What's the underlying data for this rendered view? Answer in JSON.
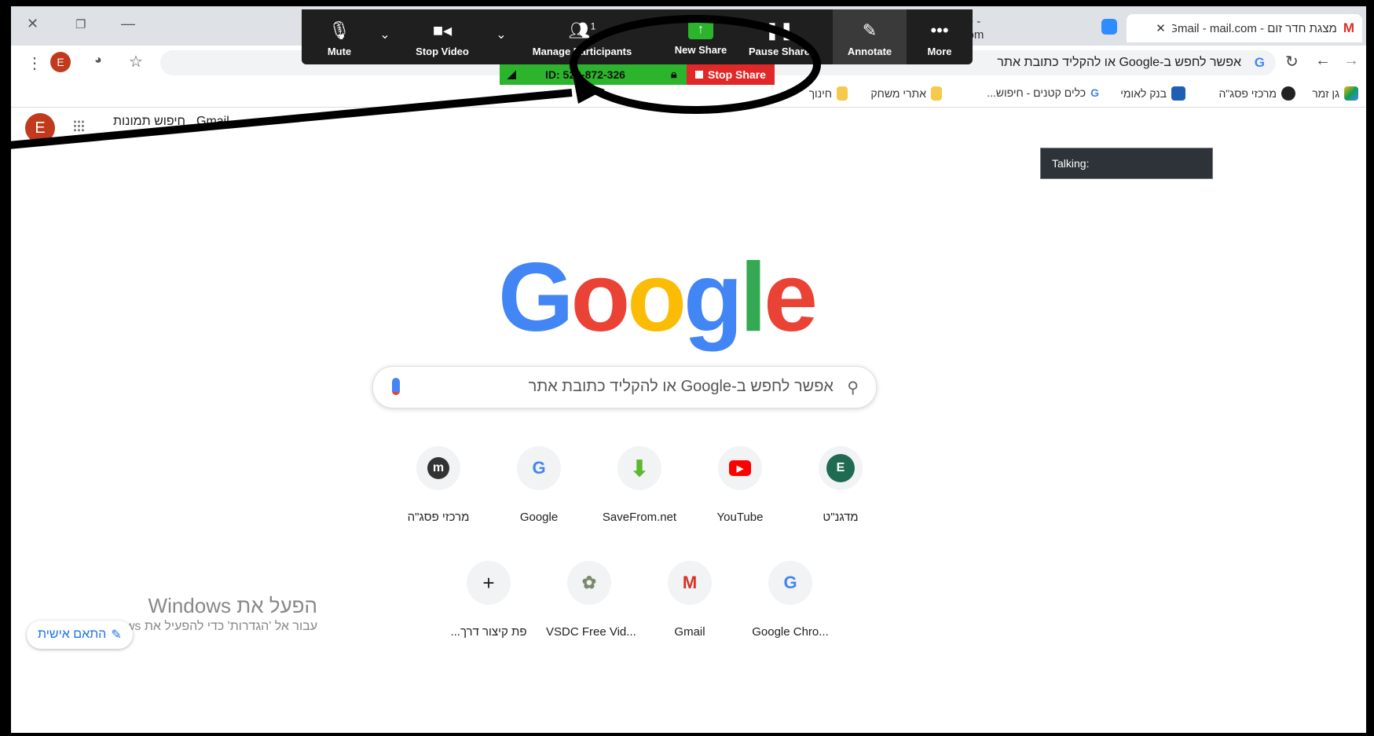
{
  "browser": {
    "tabs": [
      {
        "title": "dee - Zoom"
      },
      {
        "title": "מצגת חדר זום - Gmail - mail.com"
      }
    ],
    "omnibox_text": "אפשר לחפש ב-Google או להקליד כתובת אתר",
    "profile_initial": "E",
    "bookmarks": [
      {
        "label": "גן זמר"
      },
      {
        "label": "מרכזי פסג\"ה"
      },
      {
        "label": "בנק לאומי"
      },
      {
        "label": "כלים קטנים - חיפוש..."
      },
      {
        "label": "אתרי משחק"
      },
      {
        "label": "חינוך"
      }
    ]
  },
  "google_bar": {
    "gmail": "Gmail",
    "images": "חיפוש תמונות",
    "avatar_initial": "E"
  },
  "talking_label": "Talking:",
  "search": {
    "placeholder": "אפשר לחפש ב-Google או להקליד כתובת אתר"
  },
  "shortcuts": [
    {
      "label": "מדגנ\"ט",
      "icon": "E"
    },
    {
      "label": "YouTube",
      "icon": "▶"
    },
    {
      "label": "SaveFrom.net",
      "icon": "⬇"
    },
    {
      "label": "Google",
      "icon": "G"
    },
    {
      "label": "מרכזי פסג\"ה",
      "icon": "m"
    },
    {
      "label": "Google Chro...",
      "icon": "G"
    },
    {
      "label": "Gmail",
      "icon": "M"
    },
    {
      "label": "VSDC Free Vid...",
      "icon": "✿"
    },
    {
      "label": "...פת קיצור דרך",
      "icon": "+"
    }
  ],
  "windows_activation": {
    "title": "הפעל את Windows",
    "subtitle": "עבור אל 'הגדרות' כדי להפעיל את Windows."
  },
  "customize_label": "התאם אישית",
  "zoom_toolbar": {
    "mute": "Mute",
    "stop_video": "Stop Video",
    "manage_participants": "Manage Participants",
    "participant_count": "1",
    "new_share": "New Share",
    "pause_share": "Pause Share",
    "annotate": "Annotate",
    "more": "More",
    "share_id": "ID: 523-872-326",
    "stop_share": "Stop Share"
  },
  "colors": {
    "google_blue": "#4285f4",
    "google_red": "#ea4335",
    "google_yellow": "#fbbc05",
    "google_green": "#34a853",
    "zoom_green": "#2cb52c",
    "zoom_red": "#e02828"
  }
}
